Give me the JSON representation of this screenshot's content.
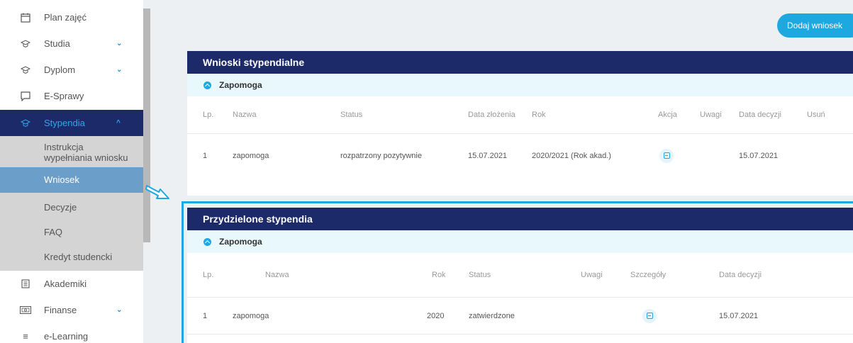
{
  "sidebar": {
    "items": [
      {
        "label": "Plan zajęć",
        "icon": "calendar-icon"
      },
      {
        "label": "Studia",
        "icon": "graduation-cap-icon"
      },
      {
        "label": "Dyplom",
        "icon": "graduation-cap-icon"
      },
      {
        "label": "E-Sprawy",
        "icon": "chat-icon"
      },
      {
        "label": "Stypendia",
        "icon": "graduation-cap-icon"
      },
      {
        "label": "Akademiki",
        "icon": "building-icon"
      },
      {
        "label": "Finanse",
        "icon": "money-icon"
      },
      {
        "label": "e-Learning",
        "icon": "menu-lines-icon"
      }
    ],
    "sub_items": [
      {
        "label": "Instrukcja wypełniania wniosku"
      },
      {
        "label": "Wniosek"
      },
      {
        "label": "Decyzje"
      },
      {
        "label": "FAQ"
      },
      {
        "label": "Kredyt studencki"
      }
    ]
  },
  "toolbar": {
    "add_label": "Dodaj wniosek"
  },
  "card1": {
    "title": "Wnioski stypendialne",
    "section": "Zapomoga",
    "headers": [
      "Lp.",
      "Nazwa",
      "Status",
      "Data złożenia",
      "Rok",
      "Akcja",
      "Uwagi",
      "Data decyzji",
      "Usuń"
    ],
    "row": {
      "lp": "1",
      "nazwa": "zapomoga",
      "status": "rozpatrzony pozytywnie",
      "data_zlozenia": "15.07.2021",
      "rok": "2020/2021 (Rok akad.)",
      "uwagi": "",
      "data_decyzji": "15.07.2021"
    }
  },
  "card2": {
    "title": "Przydzielone stypendia",
    "section": "Zapomoga",
    "headers": [
      "Lp.",
      "Nazwa",
      "Rok",
      "Status",
      "Uwagi",
      "Szczegóły",
      "Data decyzji"
    ],
    "row": {
      "lp": "1",
      "nazwa": "zapomoga",
      "rok": "2020",
      "status": "zatwierdzone",
      "uwagi": "",
      "data_decyzji": "15.07.2021"
    }
  },
  "colors": {
    "navy": "#1c2a6a",
    "accent": "#1ea8e0",
    "active_sub": "#6b9ec9"
  }
}
